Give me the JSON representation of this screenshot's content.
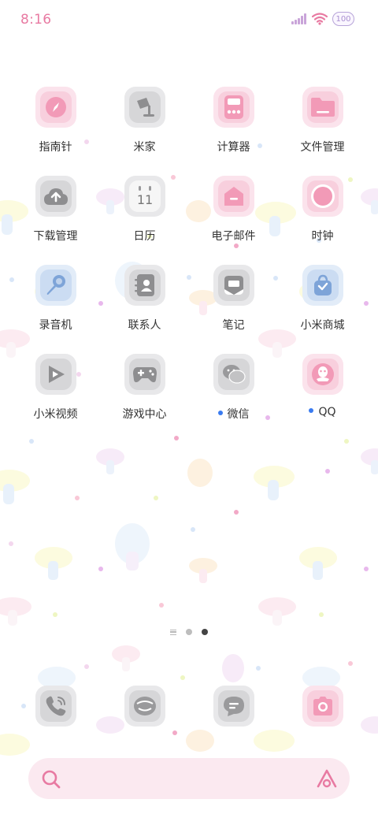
{
  "status_bar": {
    "time": "8:16",
    "battery": "100",
    "signal_icon": "cellular-signal-icon",
    "wifi_icon": "wifi-icon"
  },
  "apps": [
    {
      "label": "指南针",
      "icon": "compass-icon",
      "tint": "pink"
    },
    {
      "label": "米家",
      "icon": "lamp-icon",
      "tint": "gray"
    },
    {
      "label": "计算器",
      "icon": "calculator-icon",
      "tint": "pink"
    },
    {
      "label": "文件管理",
      "icon": "folder-icon",
      "tint": "pink"
    },
    {
      "label": "下载管理",
      "icon": "cloud-download-icon",
      "tint": "gray"
    },
    {
      "label": "日历",
      "icon": "calendar-icon",
      "tint": "gray",
      "badge_text": "11"
    },
    {
      "label": "电子邮件",
      "icon": "mail-icon",
      "tint": "pink"
    },
    {
      "label": "时钟",
      "icon": "clock-icon",
      "tint": "pink"
    },
    {
      "label": "录音机",
      "icon": "microphone-icon",
      "tint": "blue"
    },
    {
      "label": "联系人",
      "icon": "contacts-icon",
      "tint": "gray"
    },
    {
      "label": "笔记",
      "icon": "notes-icon",
      "tint": "gray"
    },
    {
      "label": "小米商城",
      "icon": "shopping-bag-icon",
      "tint": "blue"
    },
    {
      "label": "小米视频",
      "icon": "video-play-icon",
      "tint": "gray"
    },
    {
      "label": "游戏中心",
      "icon": "gamepad-icon",
      "tint": "gray"
    },
    {
      "label": "微信",
      "icon": "wechat-icon",
      "tint": "gray",
      "notification_dot": true
    },
    {
      "label": "QQ",
      "icon": "qq-icon",
      "tint": "pink",
      "notification_dot": true
    }
  ],
  "pager": {
    "pages": 2,
    "active_page": 2
  },
  "dock": [
    {
      "icon": "phone-icon",
      "tint": "gray"
    },
    {
      "icon": "browser-icon",
      "tint": "gray"
    },
    {
      "icon": "messages-icon",
      "tint": "gray"
    },
    {
      "icon": "camera-icon",
      "tint": "pink"
    }
  ],
  "search": {
    "search_icon": "search-icon",
    "assistant_icon": "assistant-icon"
  },
  "colors": {
    "accent_pink": "#e87aa2",
    "icon_pink": "#f29ab7",
    "icon_gray": "#9a9a9c",
    "icon_blue": "#7ea4d8",
    "notification_blue": "#3a7bf0"
  }
}
